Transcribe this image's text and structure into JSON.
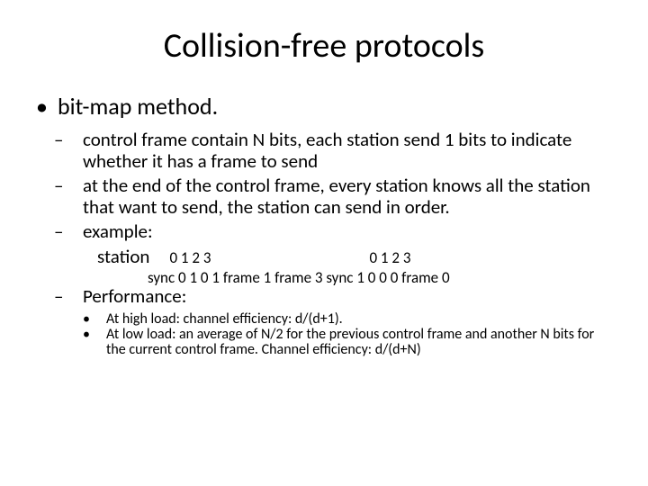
{
  "title": "Collision-free protocols",
  "lvl1_bitmap": "bit-map method.",
  "lvl2_ctrl": "control frame contain N bits, each station send 1 bits to indicate whether it has a frame to send",
  "lvl2_end": "at the end of the control frame, every station knows all the station that want to send, the station can send in order.",
  "lvl2_example": "example:",
  "ex_station": "station",
  "ex_d1": "0 1 2 3",
  "ex_d2": "0 1 2 3",
  "ex_row2": "sync  0 1 0 1   frame 1   frame 3  sync 1 0 0 0    frame 0",
  "lvl2_perf": "Performance:",
  "lvl3_high": "At high load: channel efficiency: d/(d+1).",
  "lvl3_low": "At low load: an average of N/2 for the previous control frame and another N bits  for the current control frame. Channel efficiency: d/(d+N)"
}
